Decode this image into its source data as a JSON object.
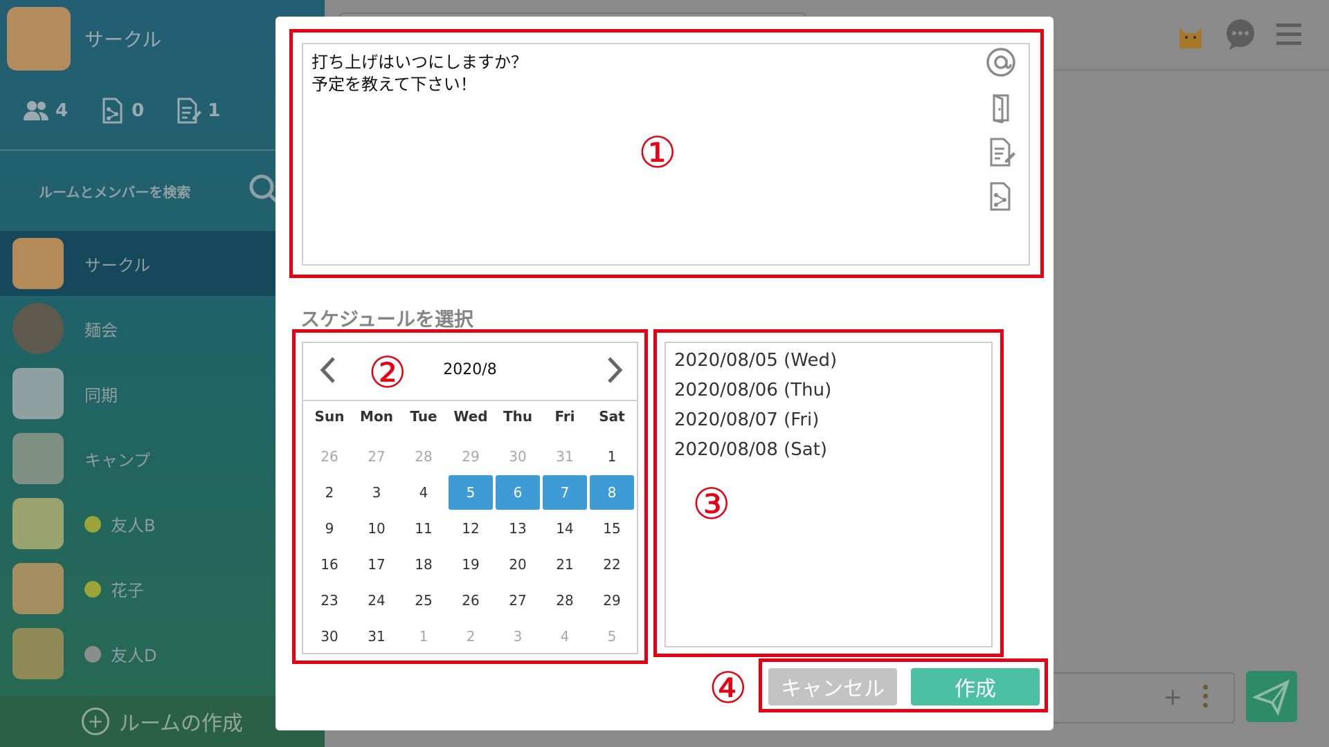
{
  "sidebar": {
    "circle_name": "サークル",
    "stats": {
      "members": "4",
      "shared_files": "0",
      "notes": "1"
    },
    "search_label": "ルームとメンバーを検索",
    "rooms": [
      {
        "name": "サークル"
      },
      {
        "name": "麺会"
      },
      {
        "name": "同期"
      },
      {
        "name": "キャンプ"
      },
      {
        "name": "友人B"
      },
      {
        "name": "花子"
      },
      {
        "name": "友人D"
      }
    ],
    "create_room_label": "ルームの作成"
  },
  "modal": {
    "message_text": "打ち上げはいつにしますか？\n予定を教えて下さい！",
    "markers": {
      "one": "①",
      "two": "②",
      "three": "③",
      "four": "④"
    },
    "schedule_label": "スケジュールを選択",
    "calendar": {
      "month_title": "2020/8",
      "weekdays": [
        "Sun",
        "Mon",
        "Tue",
        "Wed",
        "Thu",
        "Fri",
        "Sat"
      ],
      "days": [
        {
          "d": "26",
          "other": true
        },
        {
          "d": "27",
          "other": true
        },
        {
          "d": "28",
          "other": true
        },
        {
          "d": "29",
          "other": true
        },
        {
          "d": "30",
          "other": true
        },
        {
          "d": "31",
          "other": true
        },
        {
          "d": "1"
        },
        {
          "d": "2"
        },
        {
          "d": "3"
        },
        {
          "d": "4"
        },
        {
          "d": "5",
          "sel": true
        },
        {
          "d": "6",
          "sel": true
        },
        {
          "d": "7",
          "sel": true
        },
        {
          "d": "8",
          "sel": true
        },
        {
          "d": "9"
        },
        {
          "d": "10"
        },
        {
          "d": "11"
        },
        {
          "d": "12"
        },
        {
          "d": "13"
        },
        {
          "d": "14"
        },
        {
          "d": "15"
        },
        {
          "d": "16"
        },
        {
          "d": "17"
        },
        {
          "d": "18"
        },
        {
          "d": "19"
        },
        {
          "d": "20"
        },
        {
          "d": "21"
        },
        {
          "d": "22"
        },
        {
          "d": "23"
        },
        {
          "d": "24"
        },
        {
          "d": "25"
        },
        {
          "d": "26"
        },
        {
          "d": "27"
        },
        {
          "d": "28"
        },
        {
          "d": "29"
        },
        {
          "d": "30"
        },
        {
          "d": "31"
        },
        {
          "d": "1",
          "other": true
        },
        {
          "d": "2",
          "other": true
        },
        {
          "d": "3",
          "other": true
        },
        {
          "d": "4",
          "other": true
        },
        {
          "d": "5",
          "other": true
        }
      ]
    },
    "selected_dates": [
      "2020/08/05 (Wed)",
      "2020/08/06 (Thu)",
      "2020/08/07 (Fri)",
      "2020/08/08 (Sat)"
    ],
    "cancel_label": "キャンセル",
    "create_label": "作成"
  },
  "colors": {
    "accent_red": "#e60012",
    "selected_day": "#3e9bd6",
    "create_button": "#4cc0a2",
    "cancel_button": "#c3c3c3"
  }
}
